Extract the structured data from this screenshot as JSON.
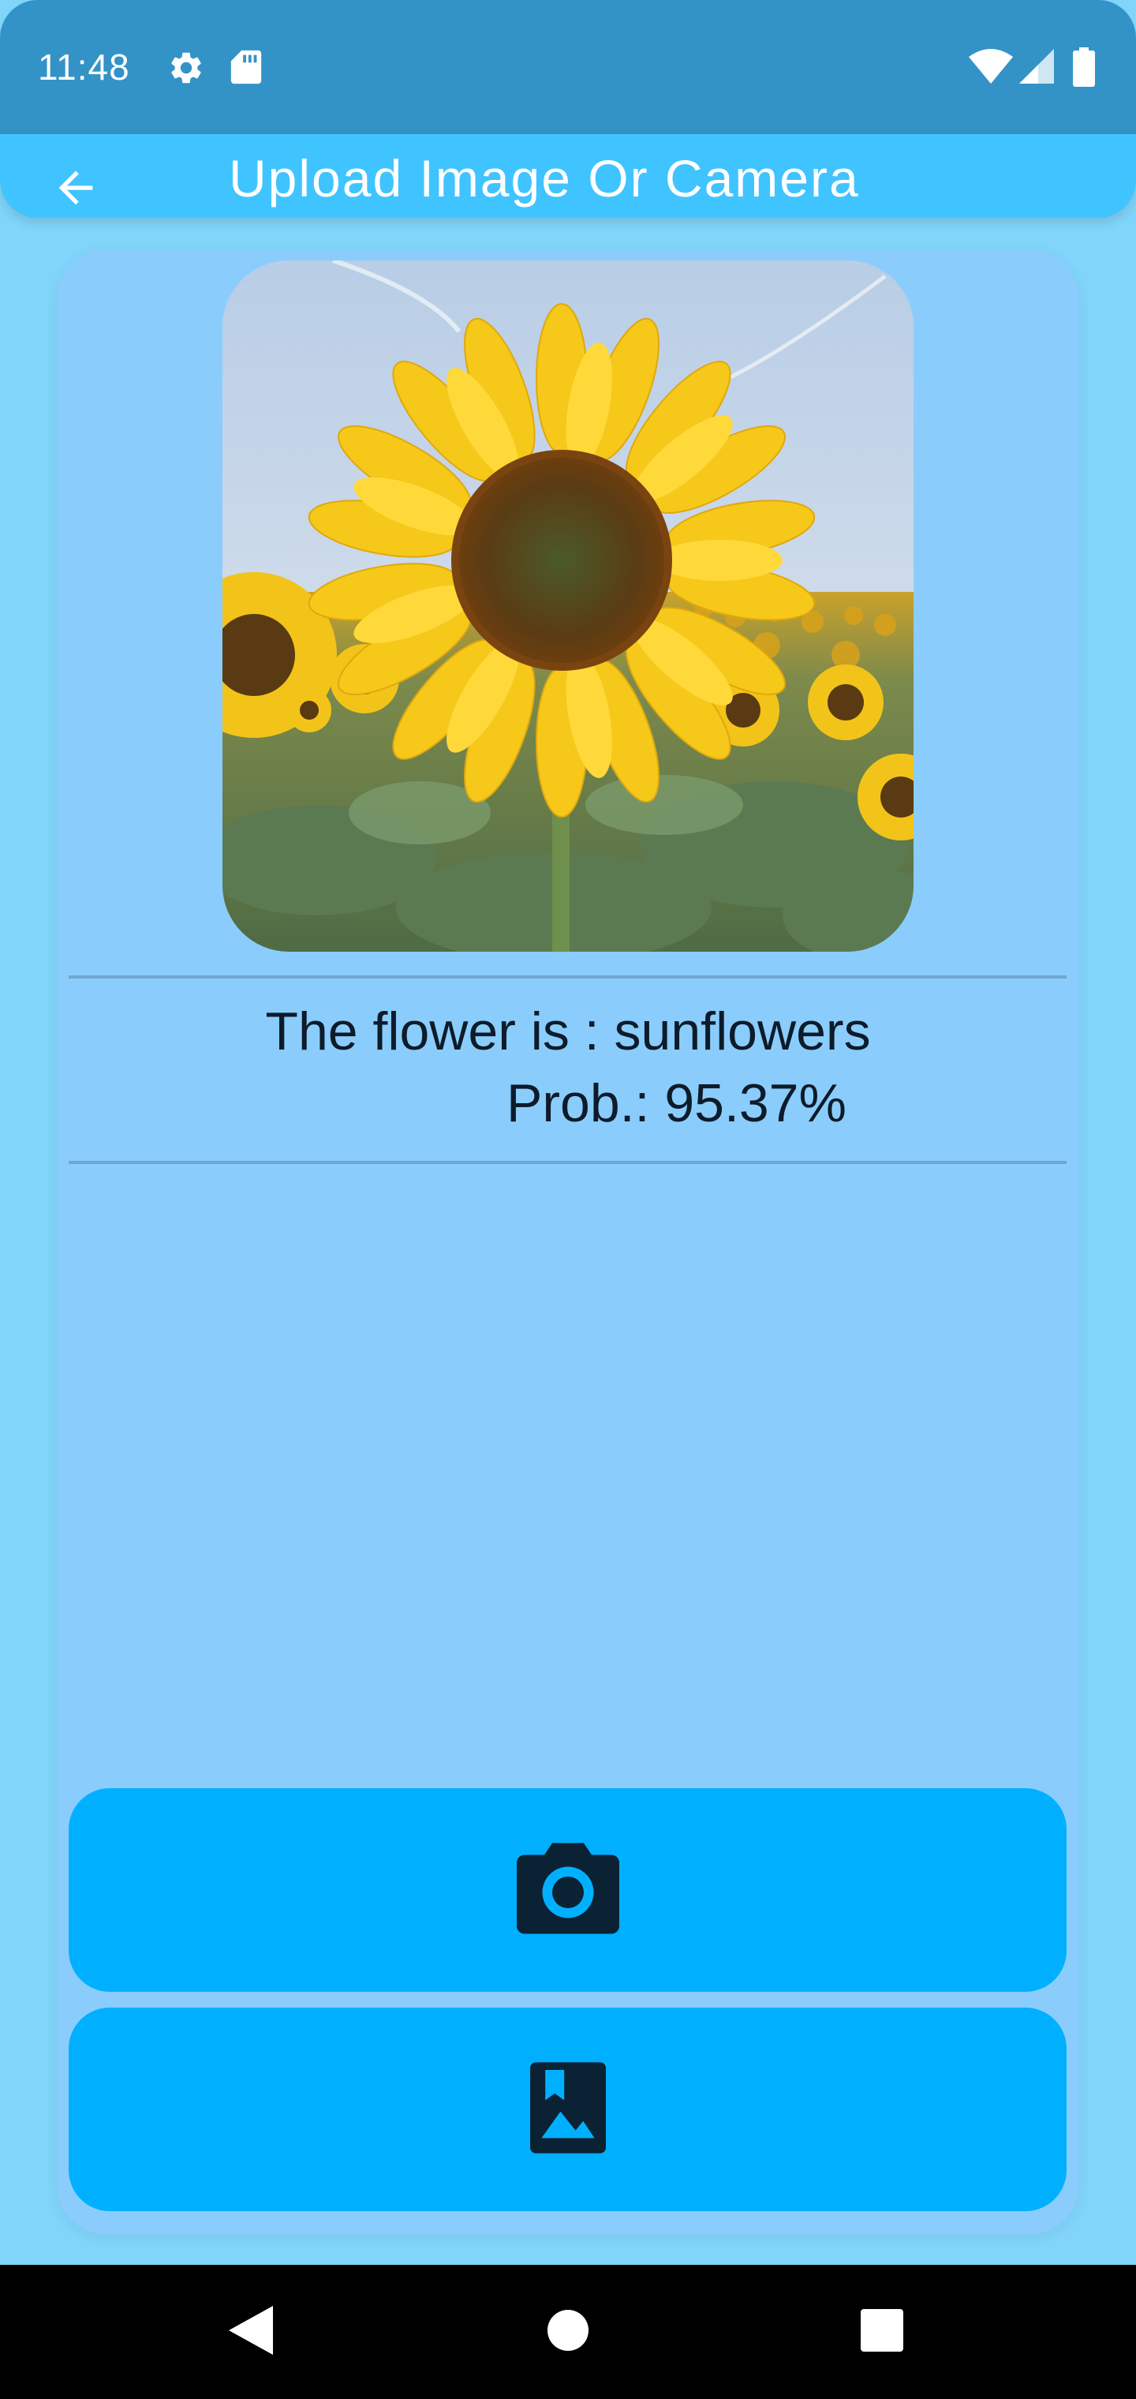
{
  "status_bar": {
    "time": "11:48",
    "icons_left": [
      "gear-icon",
      "sd-card-icon"
    ],
    "icons_right": [
      "wifi-icon",
      "cellular-signal-icon",
      "battery-icon"
    ]
  },
  "app_bar": {
    "title": "Upload Image Or Camera",
    "back_icon": "arrow-back-icon"
  },
  "result": {
    "flower_text": "The flower is : sunflowers",
    "prob_text": "Prob.: 95.37%"
  },
  "buttons": {
    "camera": {
      "icon": "camera-icon"
    },
    "gallery": {
      "icon": "photo-album-icon"
    }
  },
  "navigation": {
    "items": [
      "back-triangle-icon",
      "home-circle-icon",
      "recents-square-icon"
    ]
  },
  "colors": {
    "status_bar": "#3393c7",
    "app_bar": "#40c4ff",
    "background": "#81d4fa",
    "card": "#8acdfc",
    "button": "#00b0ff",
    "icon_dark": "#0a2233"
  }
}
